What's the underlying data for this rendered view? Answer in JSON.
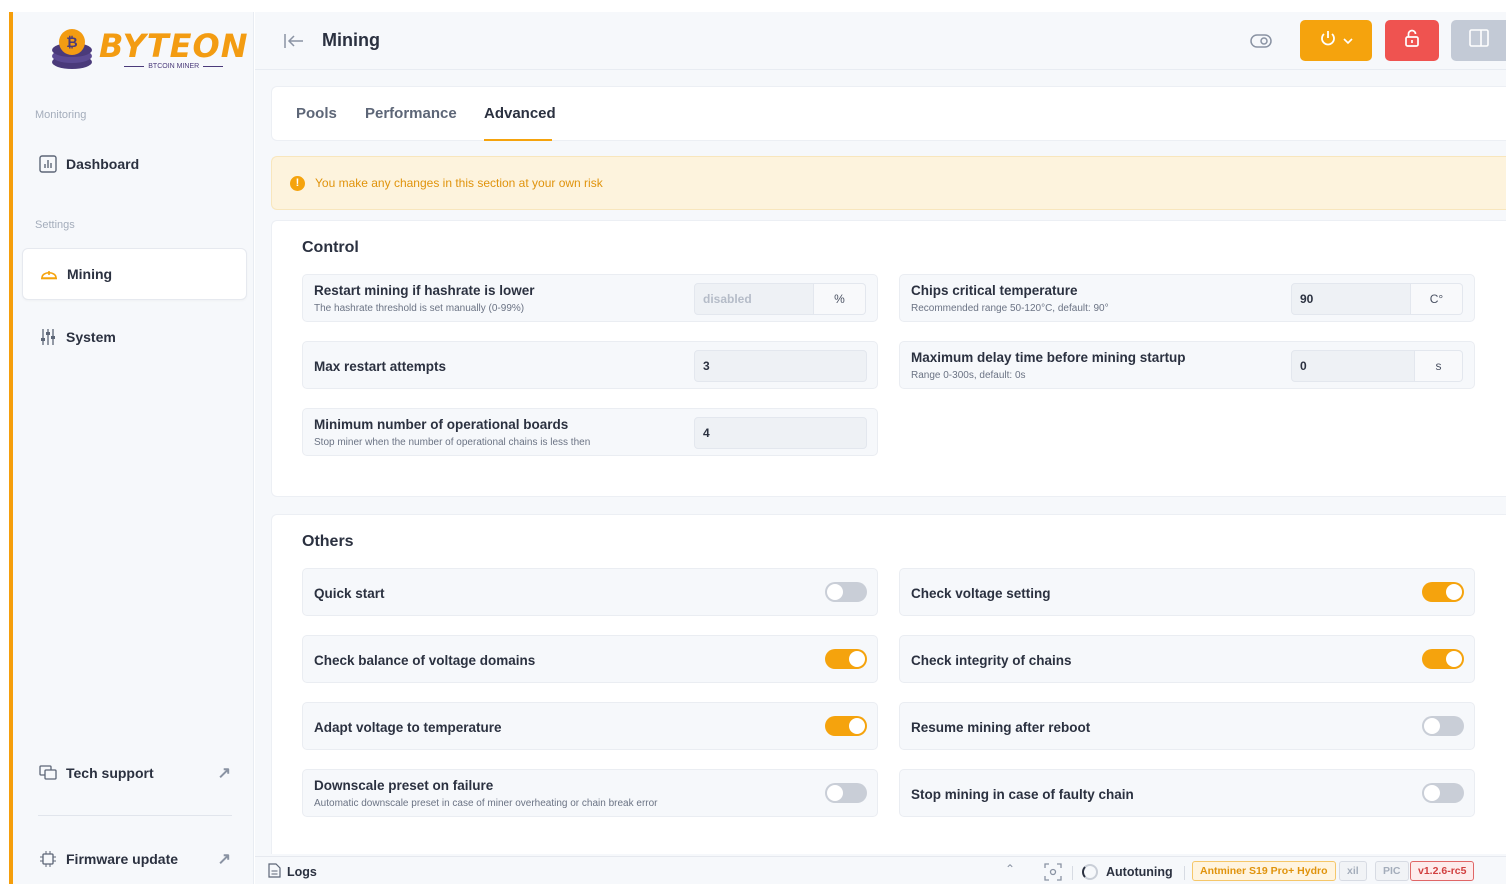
{
  "brand": {
    "name": "BYTEON",
    "tagline": "BTCOIN MINER"
  },
  "sidebar": {
    "sections": {
      "monitoring": "Monitoring",
      "settings": "Settings"
    },
    "items": [
      {
        "label": "Dashboard",
        "icon": "chart-icon"
      },
      {
        "label": "Mining",
        "icon": "helmet-icon",
        "active": true
      },
      {
        "label": "System",
        "icon": "sliders-icon"
      }
    ],
    "footer": [
      {
        "label": "Tech support",
        "icon": "chat-icon"
      },
      {
        "label": "Firmware update",
        "icon": "chip-icon"
      }
    ]
  },
  "header": {
    "title": "Mining"
  },
  "tabs": [
    {
      "label": "Pools"
    },
    {
      "label": "Performance"
    },
    {
      "label": "Advanced",
      "active": true
    }
  ],
  "warning": {
    "text": "You make any changes in this section at your own risk"
  },
  "control": {
    "title": "Control",
    "restart_hashrate": {
      "label": "Restart mining if hashrate is lower",
      "sub": "The hashrate threshold is set manually (0-99%)",
      "placeholder": "disabled",
      "unit": "%"
    },
    "chips_temp": {
      "label": "Chips critical temperature",
      "sub": "Recommended range 50-120°C, default: 90°",
      "value": "90",
      "unit": "C°"
    },
    "max_restart": {
      "label": "Max restart attempts",
      "value": "3"
    },
    "max_delay": {
      "label": "Maximum delay time before mining startup",
      "sub": "Range 0-300s, default: 0s",
      "value": "0",
      "unit": "s"
    },
    "min_boards": {
      "label": "Minimum number of operational boards",
      "sub": "Stop miner when the number of operational chains is less then",
      "value": "4"
    }
  },
  "others": {
    "title": "Others",
    "toggles": [
      {
        "label": "Quick start",
        "on": false
      },
      {
        "label": "Check voltage setting",
        "on": true
      },
      {
        "label": "Check balance of voltage domains",
        "on": true
      },
      {
        "label": "Check integrity of chains",
        "on": true
      },
      {
        "label": "Adapt voltage to temperature",
        "on": true
      },
      {
        "label": "Resume mining after reboot",
        "on": false
      },
      {
        "label": "Downscale preset on failure",
        "sub": "Automatic downscale preset in case of miner overheating or chain break error",
        "on": false
      },
      {
        "label": "Stop mining in case of faulty chain",
        "on": false
      }
    ]
  },
  "bottombar": {
    "logs": "Logs",
    "autotuning": "Autotuning",
    "model": "Antminer S19 Pro+ Hydro",
    "badge_xil": "xil",
    "badge_pic": "PIC",
    "version": "v1.2.6-rc5"
  },
  "colors": {
    "accent": "#f5a30d",
    "danger": "#ef5350",
    "warning_bg": "#fdf3dd"
  }
}
